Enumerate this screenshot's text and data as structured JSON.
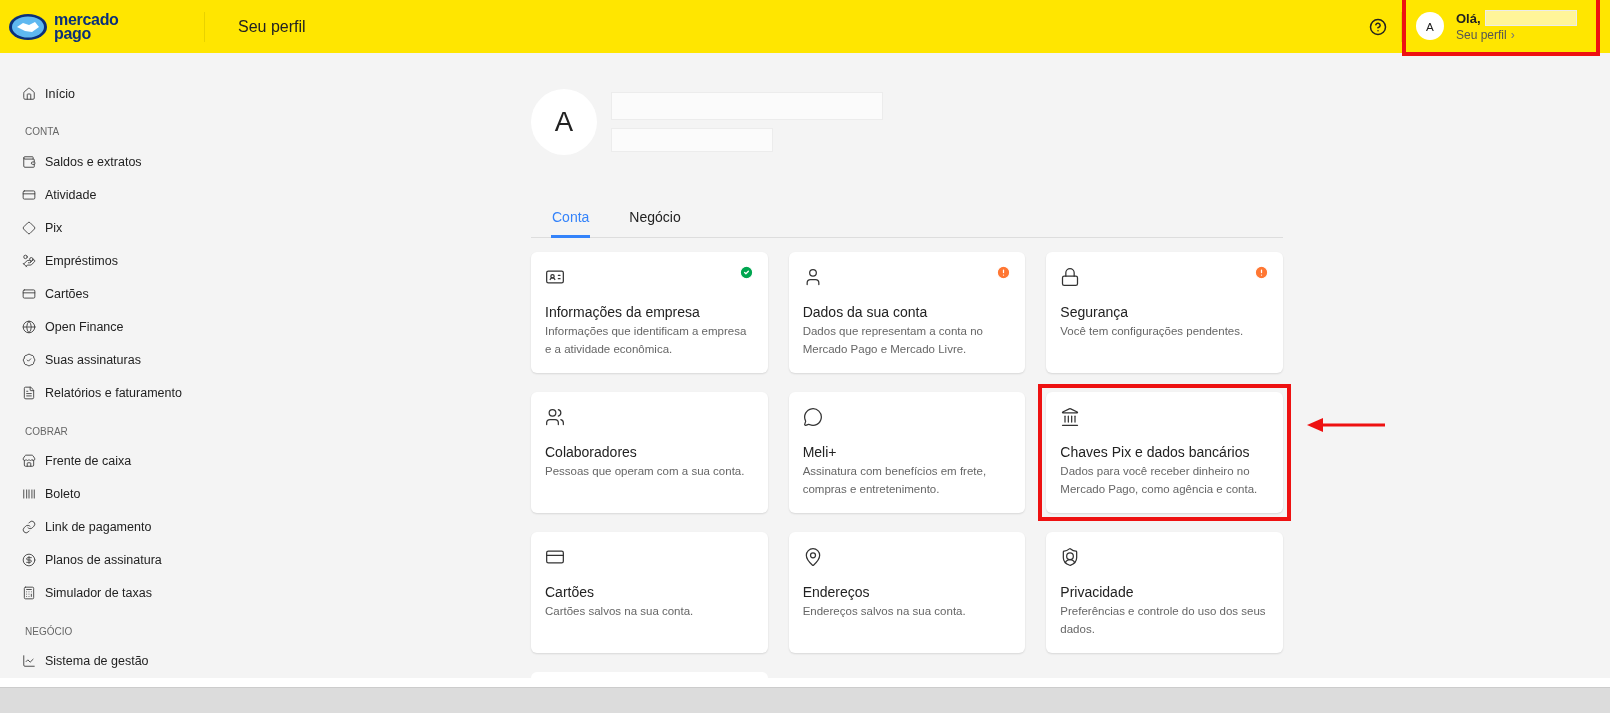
{
  "header": {
    "logo_text": [
      "mercado",
      "pago"
    ],
    "title": "Seu perfil",
    "profile": {
      "initial": "A",
      "greeting": "Olá,",
      "link": "Seu perfil",
      "chevron": "›",
      "highlighted": true
    }
  },
  "sidebar": {
    "sections": [
      {
        "items": [
          "Início"
        ]
      },
      {
        "heading": "CONTA",
        "items": [
          "Saldos e extratos",
          "Atividade",
          "Pix",
          "Empréstimos",
          "Cartões",
          "Open Finance",
          "Suas assinaturas",
          "Relatórios e faturamento"
        ]
      },
      {
        "heading": "COBRAR",
        "items": [
          "Frente de caixa",
          "Boleto",
          "Link de pagamento",
          "Planos de assinatura",
          "Simulador de taxas"
        ]
      },
      {
        "heading": "NEGÓCIO",
        "items": [
          "Sistema de gestão"
        ]
      }
    ]
  },
  "profile": {
    "initial": "A"
  },
  "tabs": [
    {
      "label": "Conta",
      "selected": true
    },
    {
      "label": "Negócio",
      "selected": false
    }
  ],
  "cards": [
    {
      "title": "Informações da empresa",
      "description": "Informações que identificam a empresa e a atividade econômica.",
      "complete": true,
      "pending": false,
      "highlighted": false
    },
    {
      "title": "Dados da sua conta",
      "description": "Dados que representam a conta no Mercado Pago e Mercado Livre.",
      "complete": false,
      "pending": true,
      "highlighted": false
    },
    {
      "title": "Segurança",
      "description": "Você tem configurações pendentes.",
      "complete": false,
      "pending": true,
      "highlighted": false
    },
    {
      "title": "Colaboradores",
      "description": "Pessoas que operam com a sua conta.",
      "complete": false,
      "pending": false,
      "highlighted": false
    },
    {
      "title": "Meli+",
      "description": "Assinatura com benefícios em frete, compras e entretenimento.",
      "complete": false,
      "pending": false,
      "highlighted": false
    },
    {
      "title": "Chaves Pix e dados bancários",
      "description": "Dados para você receber dinheiro no Mercado Pago, como agência e conta.",
      "complete": false,
      "pending": false,
      "highlighted": true
    },
    {
      "title": "Cartões",
      "description": "Cartões salvos na sua conta.",
      "complete": false,
      "pending": false,
      "highlighted": false
    },
    {
      "title": "Endereços",
      "description": "Endereços salvos na sua conta.",
      "complete": false,
      "pending": false,
      "highlighted": false
    },
    {
      "title": "Privacidade",
      "description": "Preferências e controle do uso dos seus dados.",
      "complete": false,
      "pending": false,
      "highlighted": false
    }
  ]
}
